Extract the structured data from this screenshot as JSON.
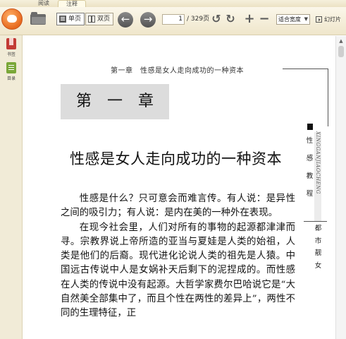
{
  "tabs": {
    "read": "阅读",
    "notes": "注释"
  },
  "toolbar": {
    "single_page": "单页",
    "double_page": "双页",
    "current_page": "1",
    "total_pages": "/ 329页",
    "zoom_option": "适合宽度",
    "slideshow": "幻灯片",
    "icons": [
      "app-logo-icon",
      "open-folder-icon",
      "previous-page-icon",
      "next-page-icon",
      "rotate-left-icon",
      "rotate-right-icon",
      "zoom-in-icon",
      "zoom-out-icon"
    ]
  },
  "sidebar": {
    "bookmarks": "书签",
    "toc": "目录"
  },
  "book": {
    "running_head": "第一章　性感是女人走向成功的一种资本",
    "chapter_label": "第一章",
    "chapter_title": "性感是女人走向成功的一种资本",
    "paragraphs": [
      "性感是什么？只可意会而难言传。有人说：是异性之间的吸引力；有人说：是内在美的一种外在表现。",
      "在现今社会里，人们对所有的事物的起源都津津而寻。宗教界说上帝所造的亚当与夏娃是人类的始祖，人类是他们的后裔。现代进化论说人类的祖先是人猿。中国远古传说中人是女娲补天后剩下的泥捏成的。而性感在人类的传说中没有起源。大哲学家费尔巴哈说它是“大自然美全部集中了，而且个性在两性的差异上”，两性不同的生理特征，正"
    ],
    "side_header": "性感教程",
    "side_pinyin": "XINGGANJIAOCHENG",
    "side_sub": "都市靓女"
  }
}
